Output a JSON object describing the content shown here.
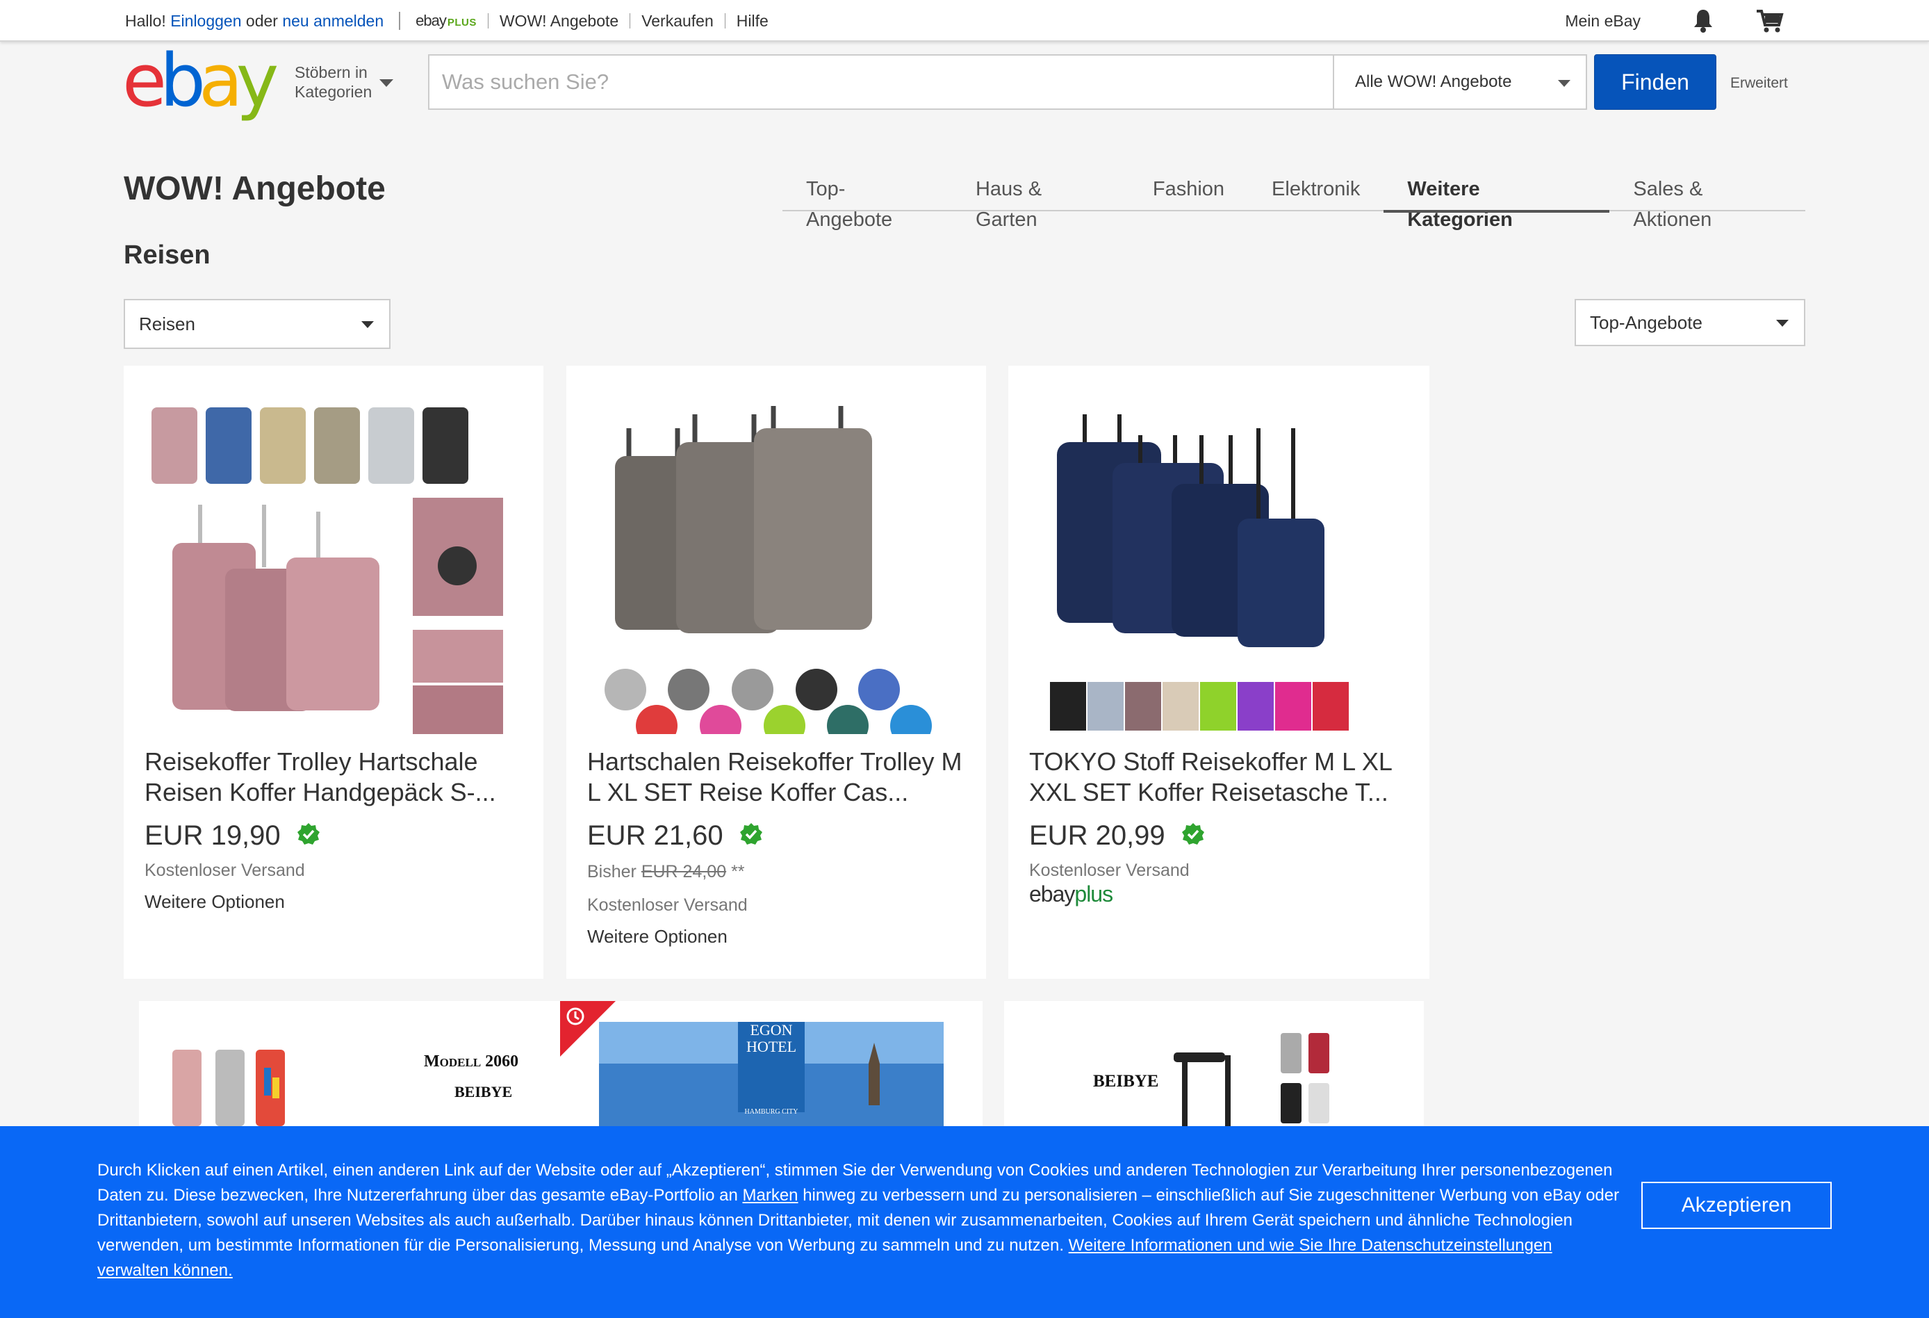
{
  "topbar": {
    "greeting": "Hallo!",
    "login_link": "Einloggen",
    "or_text": "oder",
    "register_link": "neu anmelden",
    "ebayplus_e": "ebay",
    "ebayplus_p": "PLUS",
    "nav": [
      "WOW! Angebote",
      "Verkaufen",
      "Hilfe"
    ],
    "mein_ebay": "Mein eBay"
  },
  "header": {
    "browse_line1": "Stöbern in",
    "browse_line2": "Kategorien",
    "search_placeholder": "Was suchen Sie?",
    "category_select": "Alle WOW! Angebote",
    "find_button": "Finden",
    "advanced_link": "Erweitert",
    "logo_letters": [
      "e",
      "b",
      "a",
      "y"
    ],
    "logo_colors": [
      "#e53238",
      "#0064d2",
      "#f5af02",
      "#86b817"
    ]
  },
  "page": {
    "title": "WOW! Angebote",
    "tabs": [
      "Top-Angebote",
      "Haus & Garten",
      "Fashion",
      "Elektronik",
      "Weitere Kategorien",
      "Sales & Aktionen"
    ],
    "active_tab": "Weitere Kategorien",
    "section_title": "Reisen",
    "filter_category": "Reisen",
    "sort": "Top-Angebote"
  },
  "products": [
    {
      "title": "Reisekoffer Trolley Hartschale Reisen Koffer Handgepäck S-...",
      "price": "EUR 19,90",
      "shipping": "Kostenloser Versand",
      "more": "Weitere Optionen"
    },
    {
      "title": "Hartschalen Reisekoffer Trolley M L XL SET Reise Koffer Cas...",
      "price": "EUR 21,60",
      "was_label": "Bisher",
      "was_price": "EUR 24,00",
      "was_suffix": "**",
      "shipping": "Kostenloser Versand",
      "more": "Weitere Optionen"
    },
    {
      "title": "TOKYO Stoff Reisekoffer M L XL XXL SET Koffer Reisetasche T...",
      "price": "EUR 20,99",
      "shipping": "Kostenloser Versand",
      "ebayplus_e": "ebay",
      "ebayplus_p": "plus"
    }
  ],
  "second_row": {
    "model_label": "Modell 2060",
    "brand_1": "BEIBYE",
    "hotel_line1": "EGON",
    "hotel_line2": "HOTEL",
    "hotel_line3": "HAMBURG CITY",
    "brand_2": "BEIBYE"
  },
  "cookie": {
    "text_1": "Durch Klicken auf einen Artikel, einen anderen Link auf der Website oder auf „Akzeptieren“, stimmen Sie der Verwendung von Cookies und anderen Technologien zur Verarbeitung Ihrer personenbezogenen Daten zu. Diese bezwecken, Ihre Nutzererfahrung über das gesamte eBay-Portfolio an ",
    "link_marken": "Marken",
    "text_2": " hinweg zu verbessern und zu personalisieren – einschließlich auf Sie zugeschnittener Werbung von eBay oder Drittanbietern, sowohl auf unseren Websites als auch außerhalb. Darüber hinaus können Drittanbieter, mit denen wir zusammenarbeiten, Cookies auf Ihrem Gerät speichern und ähnliche Technologien verwenden, um bestimmte Informationen für die Personalisierung, Messung und Analyse von Werbung zu sammeln und zu nutzen. ",
    "link_more": "Weitere Informationen und wie Sie Ihre Datenschutzeinstellungen verwalten können.",
    "accept_button": "Akzeptieren"
  }
}
